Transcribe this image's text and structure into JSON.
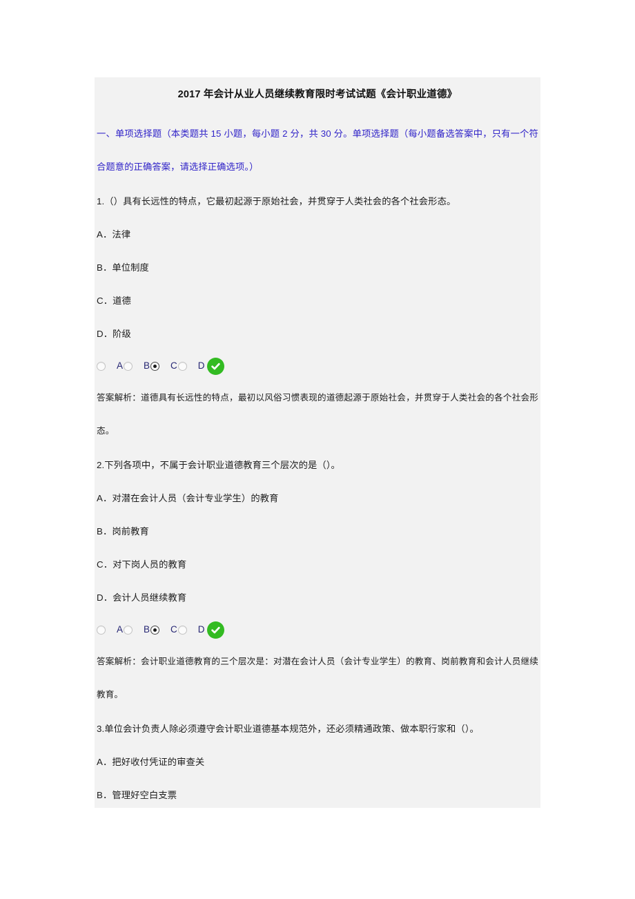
{
  "document": {
    "title": "2017 年会计从业人员继续教育限时考试试题《会计职业道德》",
    "section_heading": "一、单项选择题（本类题共 15 小题，每小题 2 分，共 30 分。单项选择题（每小题备选答案中，只有一个符合题意的正确答案，请选择正确选项。）",
    "section_heading_color": "#3124c8",
    "panel_background": "#f2f2f2",
    "page_background": "#ffffff",
    "correct_marker_color": "#33bb22",
    "option_letter_color": "#262673"
  },
  "questions": [
    {
      "stem": "1.（）具有长远性的特点，它最初起源于原始社会，并贯穿于人类社会的各个社会形态。",
      "options": [
        "A．法律",
        "B．单位制度",
        "C．道德",
        "D．阶级"
      ],
      "answer_row": {
        "letters": [
          "A",
          "B",
          "C",
          "D"
        ],
        "selected": "B",
        "correct": "D",
        "lead_radio_state": "unchecked"
      },
      "explanation": "答案解析：道德具有长远性的特点，最初以风俗习惯表现的道德起源于原始社会，并贯穿于人类社会的各个社会形态。"
    },
    {
      "stem": "2.下列各项中，不属于会计职业道德教育三个层次的是（）。",
      "options": [
        "A．对潜在会计人员（会计专业学生）的教育",
        "B．岗前教育",
        "C．对下岗人员的教育",
        "D．会计人员继续教育"
      ],
      "answer_row": {
        "letters": [
          "A",
          "B",
          "C",
          "D"
        ],
        "selected": "B",
        "correct": "D",
        "lead_radio_state": "unchecked"
      },
      "explanation": "答案解析：会计职业道德教育的三个层次是：对潜在会计人员（会计专业学生）的教育、岗前教育和会计人员继续教育。"
    },
    {
      "stem": "3.单位会计负责人除必须遵守会计职业道德基本规范外，还必须精通政策、做本职行家和（）。",
      "options": [
        "A．把好收付凭证的审查关",
        "B．管理好空白支票"
      ]
    }
  ]
}
